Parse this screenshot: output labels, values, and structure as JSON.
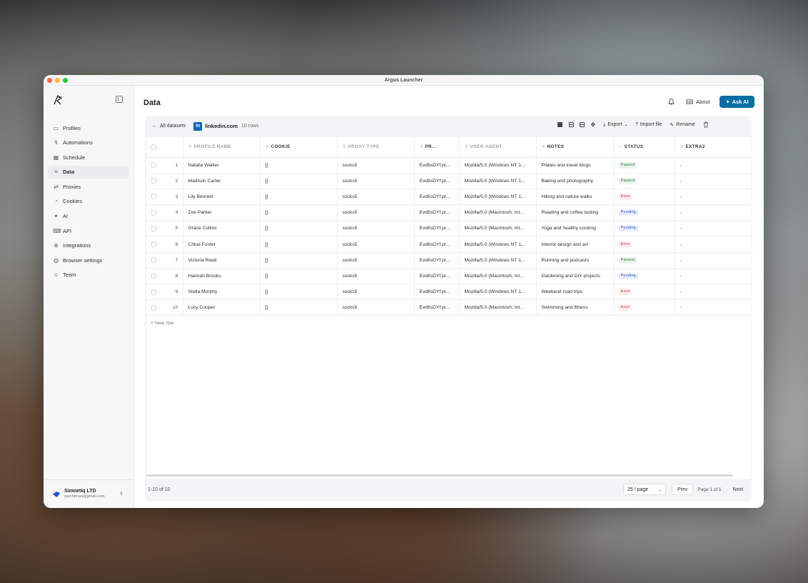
{
  "window": {
    "title": "Argus Launcher"
  },
  "sidebar": {
    "items": [
      {
        "label": "Profiles",
        "icon": "monitor-icon",
        "glyph": "▭"
      },
      {
        "label": "Automations",
        "icon": "flow-icon",
        "glyph": "↯"
      },
      {
        "label": "Schedule",
        "icon": "calendar-icon",
        "glyph": "▦"
      },
      {
        "label": "Data",
        "icon": "database-icon",
        "glyph": "≡",
        "active": true
      },
      {
        "label": "Proxies",
        "icon": "proxy-icon",
        "glyph": "⇄"
      },
      {
        "label": "Cookies",
        "icon": "cookie-icon",
        "glyph": "◔"
      },
      {
        "label": "AI",
        "icon": "sparkle-icon",
        "glyph": "✦"
      },
      {
        "label": "API",
        "icon": "api-icon",
        "glyph": "⌨"
      },
      {
        "label": "Integrations",
        "icon": "puzzle-icon",
        "glyph": "⊕"
      },
      {
        "label": "Browser settings",
        "icon": "globe-icon",
        "glyph": "◍"
      },
      {
        "label": "Team",
        "icon": "team-icon",
        "glyph": "☺"
      }
    ],
    "org": {
      "name": "Simnetiq LTD",
      "email": "rpochtman@gmail.com"
    }
  },
  "header": {
    "title": "Data",
    "about_label": "About",
    "ask_ai_label": "Ask AI"
  },
  "toolbar": {
    "back_label": "All datasets",
    "dataset_name": "linkedin.com",
    "dataset_rows": "10 rows",
    "export_label": "Export",
    "import_label": "Import file",
    "rename_label": "Rename"
  },
  "table": {
    "columns": [
      "PROFILE NAME",
      "COOKIE",
      "PROXY TYPE",
      "PR...",
      "USER AGENT",
      "NOTES",
      "STATUS",
      "EXTRA2"
    ],
    "rows": [
      {
        "index": "1",
        "name": "Natalie Walker",
        "cookie": "[]",
        "proxy_type": "socks5",
        "proxy": "Evd8sDYf:pr...",
        "user_agent": "Mozilla/5.0 (Windows NT 1...",
        "notes": "Pilates and travel blogs",
        "status": "Passed",
        "extra2": "-"
      },
      {
        "index": "2",
        "name": "Madison Carter",
        "cookie": "[]",
        "proxy_type": "socks5",
        "proxy": "Evd8sDYf:pr...",
        "user_agent": "Mozilla/5.0 (Windows NT 1...",
        "notes": "Baking and photography",
        "status": "Passed",
        "extra2": "-"
      },
      {
        "index": "3",
        "name": "Lily Bennett",
        "cookie": "[]",
        "proxy_type": "socks5",
        "proxy": "Evd8sDYf:pr...",
        "user_agent": "Mozilla/5.0 (Windows NT 1...",
        "notes": "Hiking and nature walks",
        "status": "Error",
        "extra2": "-"
      },
      {
        "index": "4",
        "name": "Zoe Parker",
        "cookie": "[]",
        "proxy_type": "socks5",
        "proxy": "Evd8sDYf:pr...",
        "user_agent": "Mozilla/5.0 (Macintosh; Int...",
        "notes": "Reading and coffee tasting",
        "status": "Pending",
        "extra2": "-"
      },
      {
        "index": "5",
        "name": "Grace Collins",
        "cookie": "[]",
        "proxy_type": "socks5",
        "proxy": "Evd8sDYf:pr...",
        "user_agent": "Mozilla/5.0 (Macintosh; Int...",
        "notes": "Yoga and healthy cooking",
        "status": "Pending",
        "extra2": "-"
      },
      {
        "index": "6",
        "name": "Chloe Foster",
        "cookie": "[]",
        "proxy_type": "socks5",
        "proxy": "Evd8sDYf:pr...",
        "user_agent": "Mozilla/5.0 (Windows NT 1...",
        "notes": "Interior design and art",
        "status": "Error",
        "extra2": "-"
      },
      {
        "index": "7",
        "name": "Victoria Reed",
        "cookie": "[]",
        "proxy_type": "socks5",
        "proxy": "Evd8sDYf:pr...",
        "user_agent": "Mozilla/5.0 (Windows NT 1...",
        "notes": "Running and podcasts",
        "status": "Passed",
        "extra2": "-"
      },
      {
        "index": "8",
        "name": "Hannah Brooks",
        "cookie": "[]",
        "proxy_type": "socks5",
        "proxy": "Evd8sDYf:pr...",
        "user_agent": "Mozilla/5.0 (Macintosh; Int...",
        "notes": "Gardening and DIY projects",
        "status": "Pending",
        "extra2": "-"
      },
      {
        "index": "9",
        "name": "Stella Murphy",
        "cookie": "[]",
        "proxy_type": "socks5",
        "proxy": "Evd8sDYf:pr...",
        "user_agent": "Mozilla/5.0 (Windows NT 1...",
        "notes": "Weekend road trips",
        "status": "Error",
        "extra2": "-"
      },
      {
        "index": "10",
        "name": "Lucy Cooper",
        "cookie": "[]",
        "proxy_type": "socks5",
        "proxy": "Evd8sDYf:pr...",
        "user_agent": "Mozilla/5.0 (Macintosh; Int...",
        "notes": "Swimming and fitness",
        "status": "Error",
        "extra2": "-"
      }
    ],
    "new_row_label": "+ New row"
  },
  "footer": {
    "count": "1-10 of 10",
    "page_size": "25 / page",
    "prev_label": "Prev",
    "page_info": "Page 1 of 1",
    "next_label": "Next"
  },
  "colors": {
    "accent": "#0b6fa4",
    "passed": "#2f7d4a",
    "error": "#d23c3c",
    "pending": "#3d5fcf"
  }
}
